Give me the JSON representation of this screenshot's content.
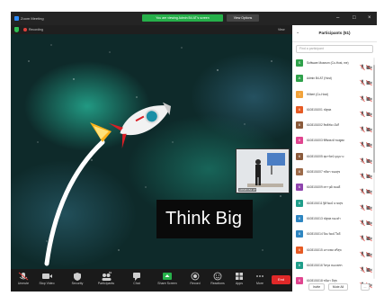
{
  "window": {
    "title": "Zoom Meeting",
    "share_banner": "You are viewing Admin B4 AT's screen",
    "view_options": "View Options",
    "controls": {
      "minimize": "–",
      "maximize": "□",
      "close": "×"
    }
  },
  "recording_bar": {
    "status": "Recording",
    "view_label": "View"
  },
  "shared_screen": {
    "slide_text": "Think Big",
    "thumbnail_name": "ADMIN B4 AT"
  },
  "toolbar": {
    "unmute": "Unmute",
    "stop_video": "Stop Video",
    "security": "Security",
    "participants": "Participants",
    "participants_count": "51",
    "chat": "Chat",
    "share_screen": "Share Screen",
    "record": "Record",
    "reactions": "Reactions",
    "apps": "Apps",
    "more": "More",
    "end": "End"
  },
  "panel": {
    "title": "Participants (51)",
    "search_placeholder": "Find a participant",
    "invite": "Invite",
    "mute_all": "Mute All",
    "more": "...",
    "participants": [
      {
        "initial": "S",
        "name": "Software Museum (Co-Host, me)",
        "color": "#2fa14b"
      },
      {
        "initial": "A",
        "name": "Admin B4 AT (Host)",
        "color": "#2fa14b"
      },
      {
        "initial": "I",
        "name": "Hilbert (Co-Host)",
        "color": "#f2a33a"
      },
      {
        "initial": "6",
        "name": "6108101001 ณัฐพล",
        "color": "#e65b24"
      },
      {
        "initial": "6",
        "name": "6108101002 สิทธิชัย เม้งกี",
        "color": "#8a5a3b"
      },
      {
        "initial": "6",
        "name": "6108101003 พิชิตพงษ์ ชมพูพล",
        "color": "#e0458f"
      },
      {
        "initial": "6",
        "name": "6108101005 สุดารัตน์ บุญบาง",
        "color": "#8a5a3b"
      },
      {
        "initial": "6",
        "name": "6108101007 ชลิตา ทองสุข",
        "color": "#9c6b4a"
      },
      {
        "initial": "6",
        "name": "6108101009 ศราวุฒิ ทองดี",
        "color": "#8e44ad"
      },
      {
        "initial": "6",
        "name": "6108101011 ฐิติวัฒน์ นาคสุข",
        "color": "#1f9e8a"
      },
      {
        "initial": "6",
        "name": "6108101013 ณัฐพล ทองคำ",
        "color": "#2e86c1"
      },
      {
        "initial": "6",
        "name": "6108101014 ปิยะวัฒน์ ใจดี",
        "color": "#2e86c1"
      },
      {
        "initial": "6",
        "name": "6108101015 อรรถพล ศรีสุข",
        "color": "#e65b24"
      },
      {
        "initial": "6",
        "name": "6108101016 วิศรุต ทองเพชร",
        "color": "#1f9e8a"
      },
      {
        "initial": "6",
        "name": "6108101018 ชนิดา มีสุข",
        "color": "#e0458f"
      }
    ]
  }
}
